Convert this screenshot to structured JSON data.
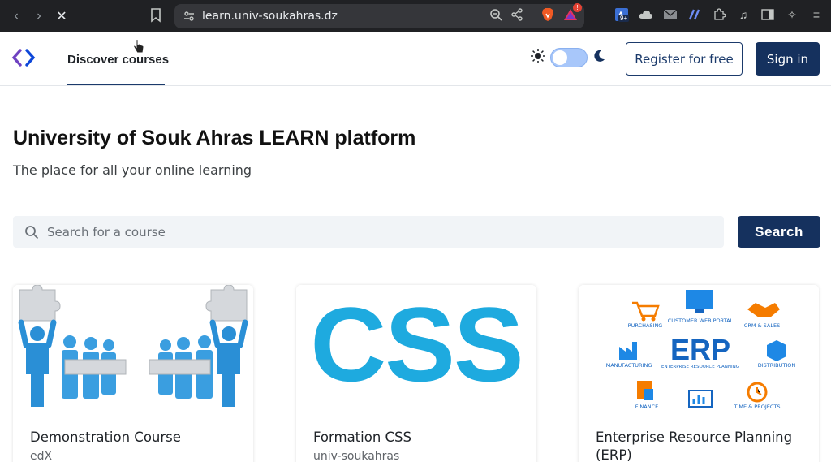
{
  "browser": {
    "url": "learn.univ-soukahras.dz",
    "extension_badge": "9+",
    "brave_badge": "!"
  },
  "header": {
    "nav_tab": "Discover courses",
    "register_label": "Register for free",
    "signin_label": "Sign in"
  },
  "hero": {
    "title": "University of Souk Ahras LEARN platform",
    "subtitle": "The place for all your online learning"
  },
  "search": {
    "placeholder": "Search for a course",
    "button_label": "Search"
  },
  "courses": [
    {
      "title": "Demonstration Course",
      "org": "edX"
    },
    {
      "title": "Formation CSS",
      "org": "univ-soukahras",
      "image_text": "CSS"
    },
    {
      "title": "Enterprise Resource Planning (ERP)",
      "org": "",
      "image_text": "ERP",
      "image_subtext": "ENTERPRISE RESOURCE PLANNING",
      "image_labels": [
        "PURCHASING",
        "CUSTOMER WEB PORTAL",
        "CRM & SALES",
        "MANUFACTURING",
        "DISTRIBUTION",
        "FINANCE",
        "TIME & PROJECTS"
      ]
    }
  ],
  "colors": {
    "primary": "#15315e",
    "accent_blue": "#1e88e5",
    "css_blue": "#1eaadf",
    "erp_blue": "#1565c0",
    "erp_orange": "#f57c00"
  }
}
